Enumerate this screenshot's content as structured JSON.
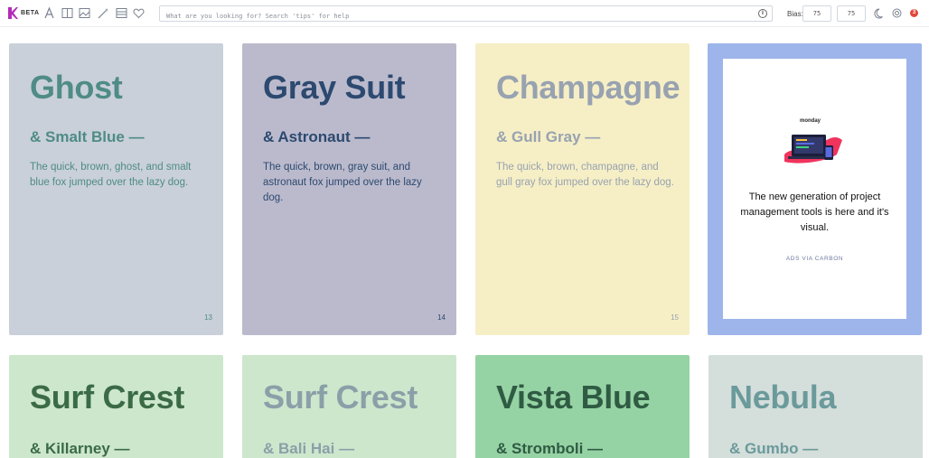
{
  "header": {
    "beta_label": "BETA",
    "tools": [
      "font-icon",
      "columns-icon",
      "image-icon",
      "magic-icon",
      "layout-icon",
      "heart-icon"
    ],
    "search": {
      "placeholder": "What are you looking for? Search 'tips' for help",
      "value": ""
    },
    "bias": {
      "label": "Bias:",
      "value1": "75",
      "value2": "75"
    },
    "notification_count": "3",
    "colors": {
      "logo": "#b42bb8",
      "notification": "#e2473b"
    }
  },
  "cards": [
    {
      "title": "Ghost",
      "subtitle": "& Smalt Blue —",
      "description": "The quick, brown, ghost, and smalt blue fox jumped over the lazy dog.",
      "number": "13",
      "bg": "#c9d0d9",
      "fg": "#4f8b87"
    },
    {
      "title": "Gray Suit",
      "subtitle": "& Astronaut —",
      "description": "The quick, brown, gray suit, and astronaut fox jumped over the lazy dog.",
      "number": "14",
      "bg": "#bbbacc",
      "fg": "#2c4970"
    },
    {
      "title": "Champagne",
      "subtitle": "& Gull Gray —",
      "description": "The quick, brown, champagne, and gull gray fox jumped over the lazy dog.",
      "number": "15",
      "bg": "#f6efc6",
      "fg": "#98a2b0"
    },
    {
      "title": "Surf Crest",
      "subtitle": "& Killarney —",
      "bg": "#cde7cd",
      "fg": "#3b6b46"
    },
    {
      "title": "Surf Crest",
      "subtitle": "& Bali Hai —",
      "bg": "#cde7cd",
      "fg": "#8aa0a8"
    },
    {
      "title": "Vista Blue",
      "subtitle": "& Stromboli —",
      "bg": "#96d3a4",
      "fg": "#2f5b43"
    },
    {
      "title": "Nebula",
      "subtitle": "& Gumbo —",
      "bg": "#d4dedb",
      "fg": "#6b9a9b"
    }
  ],
  "ad": {
    "brand": "monday",
    "text": "The new generation of project management tools is here and it's visual.",
    "via": "ADS VIA CARBON",
    "frame_color": "#9db5ea"
  }
}
